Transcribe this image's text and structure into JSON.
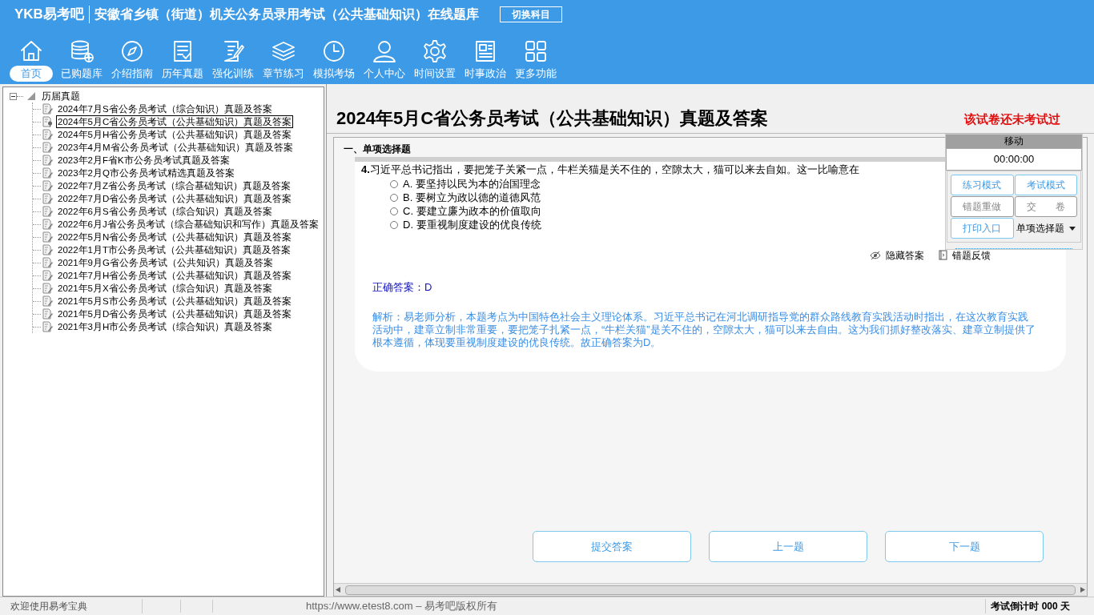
{
  "header": {
    "logo": "YKB易考吧",
    "title": "安徽省乡镇（街道）机关公务员录用考试（公共基础知识）在线题库",
    "switch_button": "切换科目"
  },
  "toolbar": [
    {
      "label": "首页",
      "selected": true
    },
    {
      "label": "已购题库",
      "selected": false
    },
    {
      "label": "介绍指南",
      "selected": false
    },
    {
      "label": "历年真题",
      "selected": false
    },
    {
      "label": "强化训练",
      "selected": false
    },
    {
      "label": "章节练习",
      "selected": false
    },
    {
      "label": "模拟考场",
      "selected": false
    },
    {
      "label": "个人中心",
      "selected": false
    },
    {
      "label": "时间设置",
      "selected": false
    },
    {
      "label": "时事政治",
      "selected": false
    },
    {
      "label": "更多功能",
      "selected": false
    }
  ],
  "tree": {
    "root": {
      "label": "历届真题",
      "expanded": true
    },
    "items": [
      {
        "label": "2024年7月S省公务员考试（综合知识）真题及答案",
        "selected": false
      },
      {
        "label": "2024年5月C省公务员考试（公共基础知识）真题及答案",
        "selected": true
      },
      {
        "label": "2024年5月H省公务员考试（公共基础知识）真题及答案",
        "selected": false
      },
      {
        "label": "2023年4月M省公务员考试（公共基础知识）真题及答案",
        "selected": false
      },
      {
        "label": "2023年2月F省K市公务员考试真题及答案",
        "selected": false
      },
      {
        "label": "2023年2月Q市公务员考试精选真题及答案",
        "selected": false
      },
      {
        "label": "2022年7月Z省公务员考试（综合基础知识）真题及答案",
        "selected": false
      },
      {
        "label": "2022年7月D省公务员考试（公共基础知识）真题及答案",
        "selected": false
      },
      {
        "label": "2022年6月S省公务员考试（综合知识）真题及答案",
        "selected": false
      },
      {
        "label": "2022年6月J省公务员考试（综合基础知识和写作）真题及答案",
        "selected": false
      },
      {
        "label": "2022年5月N省公务员考试（公共基础知识）真题及答案",
        "selected": false
      },
      {
        "label": "2022年1月T市公务员考试（公共基础知识）真题及答案",
        "selected": false
      },
      {
        "label": "2021年9月G省公务员考试（公共知识）真题及答案",
        "selected": false
      },
      {
        "label": "2021年7月H省公务员考试（公共基础知识）真题及答案",
        "selected": false
      },
      {
        "label": "2021年5月X省公务员考试（综合知识）真题及答案",
        "selected": false
      },
      {
        "label": "2021年5月S市公务员考试（公共基础知识）真题及答案",
        "selected": false
      },
      {
        "label": "2021年5月D省公务员考试（公共基础知识）真题及答案",
        "selected": false
      },
      {
        "label": "2021年3月H市公务员考试（综合知识）真题及答案",
        "selected": false
      }
    ]
  },
  "exam": {
    "title": "2024年5月C省公务员考试（公共基础知识）真题及答案",
    "status": "该试卷还未考试过"
  },
  "section": "一、单项选择题",
  "question": {
    "number": "4.",
    "text": "习近平总书记指出，要把笼子关紧一点，牛栏关猫是关不住的，空隙太大，猫可以来去自如。这一比喻意在",
    "options": [
      {
        "text": "A. 要坚持以民为本的治国理念",
        "selected": false
      },
      {
        "text": "B. 要树立为政以德的道德风范",
        "selected": false
      },
      {
        "text": "C. 要建立廉为政本的价值取向",
        "selected": false
      },
      {
        "text": "D. 要重视制度建设的优良传统",
        "selected": false
      }
    ]
  },
  "actions": [
    "隐藏答案",
    "错题反馈"
  ],
  "answer": "正确答案：D",
  "analysis": "解析：易老师分析，本题考点为中国特色社会主义理论体系。习近平总书记在河北调研指导党的群众路线教育实践活动时指出，在这次教育实践活动中，建章立制非常重要，要把笼子扎紧一点，“牛栏关猫”是关不住的，空隙太大，猫可以来去自由。这为我们抓好整改落实、建章立制提供了根本遵循，体现要重视制度建设的优良传统。故正确答案为D。",
  "panel": {
    "title": "移动",
    "timer": "00:00:00",
    "buttons": [
      {
        "label": "练习模式",
        "enabled": true
      },
      {
        "label": "考试模式",
        "enabled": true
      },
      {
        "label": "错题重做",
        "enabled": false
      },
      {
        "label": "交　　卷",
        "enabled": false
      },
      {
        "label": "打印入口",
        "enabled": true
      }
    ],
    "dropdown": "单项选择题"
  },
  "nav_buttons": [
    "提交答案",
    "上一题",
    "下一题"
  ],
  "status_bar": {
    "welcome": "欢迎使用易考宝典",
    "copyright": "https://www.etest8.com – 易考吧版权所有",
    "countdown": "考试倒计时 000 天"
  }
}
